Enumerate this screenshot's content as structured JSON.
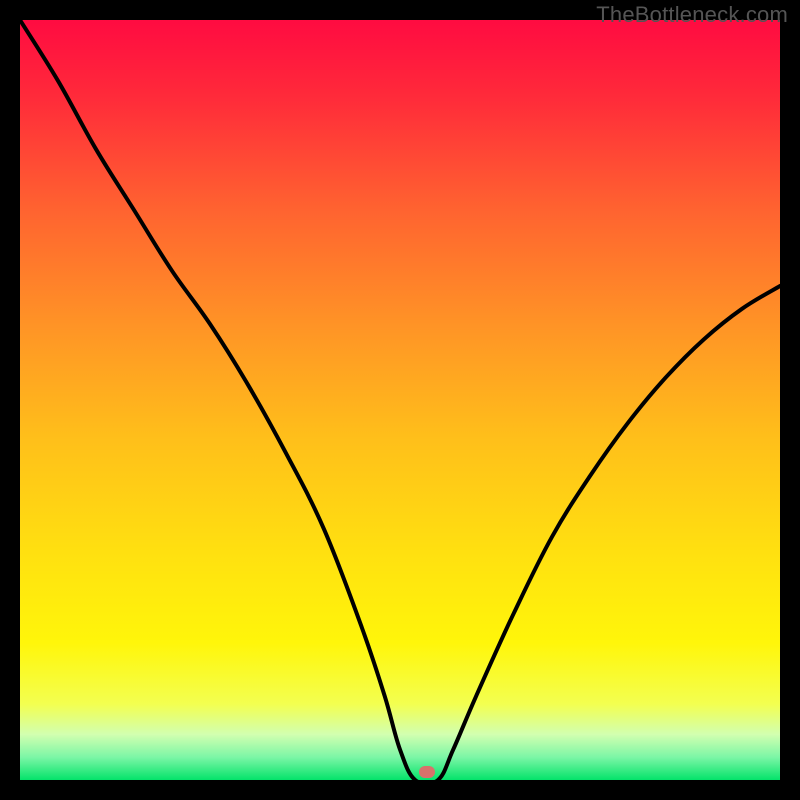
{
  "watermark": "TheBottleneck.com",
  "marker": {
    "x_pct": 53.5,
    "y_pct": 99.0
  },
  "chart_data": {
    "type": "line",
    "title": "",
    "xlabel": "",
    "ylabel": "",
    "xlim": [
      0,
      100
    ],
    "ylim": [
      0,
      100
    ],
    "background_gradient": [
      "#ff0b41",
      "#ffd900",
      "#04e36a"
    ],
    "annotations": [
      {
        "text": "TheBottleneck.com",
        "position": "top-right"
      }
    ],
    "marker_point": {
      "x": 53.5,
      "y": 0
    },
    "series": [
      {
        "name": "bottleneck-curve",
        "x": [
          0,
          5,
          10,
          15,
          20,
          25,
          30,
          35,
          40,
          45,
          48,
          50,
          52,
          55,
          57,
          60,
          65,
          70,
          75,
          80,
          85,
          90,
          95,
          100
        ],
        "values": [
          100,
          92,
          83,
          75,
          67,
          60,
          52,
          43,
          33,
          20,
          11,
          4,
          0,
          0,
          4,
          11,
          22,
          32,
          40,
          47,
          53,
          58,
          62,
          65
        ]
      }
    ]
  },
  "colors": {
    "curve": "#000000",
    "marker": "#d8726b"
  }
}
